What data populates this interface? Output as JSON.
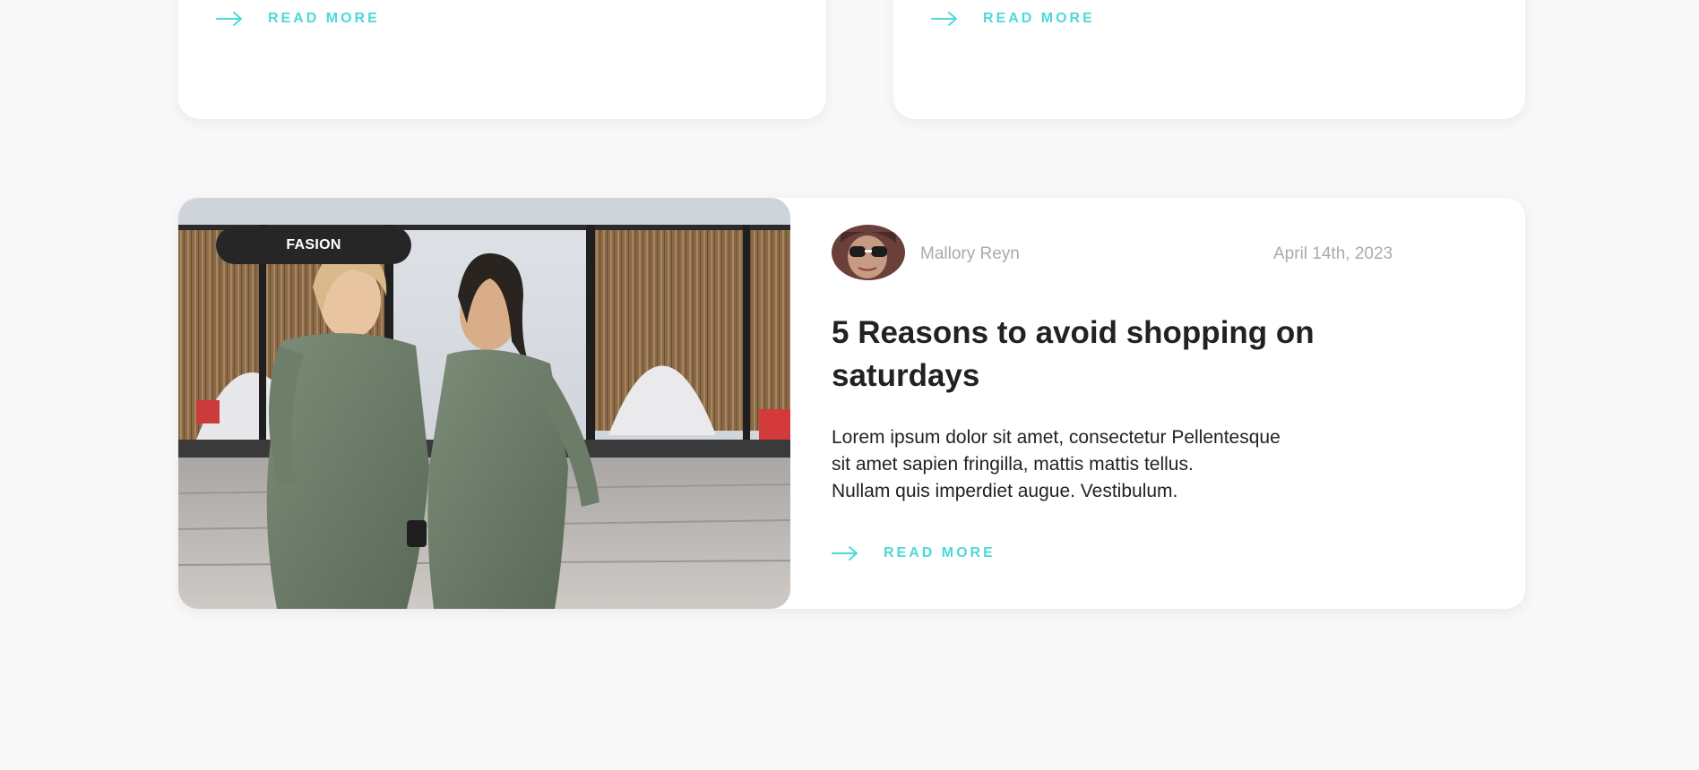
{
  "top_cards": [
    {
      "read_more_label": "READ MORE"
    },
    {
      "read_more_label": "READ MORE"
    }
  ],
  "featured_post": {
    "category": "FASION",
    "author": "Mallory Reyn",
    "date": "April 14th, 2023",
    "title": "5 Reasons to avoid shopping on saturdays",
    "excerpt_lines": [
      "Lorem ipsum dolor sit amet, consectetur Pellentesque",
      "sit amet sapien fringilla, mattis mattis tellus.",
      "Nullam quis imperdiet augue. Vestibulum."
    ],
    "read_more_label": "READ MORE",
    "image": "photo-two-women-green-dresses",
    "avatar": "author-avatar-photo"
  },
  "icons": {
    "read_more": "arrow-right-icon"
  },
  "colors": {
    "background": "#f8f8f8",
    "card": "#ffffff",
    "accent": "#4dd9d9",
    "badge_bg": "#262626",
    "meta_text": "#aaaaaa",
    "body_text": "#222222"
  }
}
